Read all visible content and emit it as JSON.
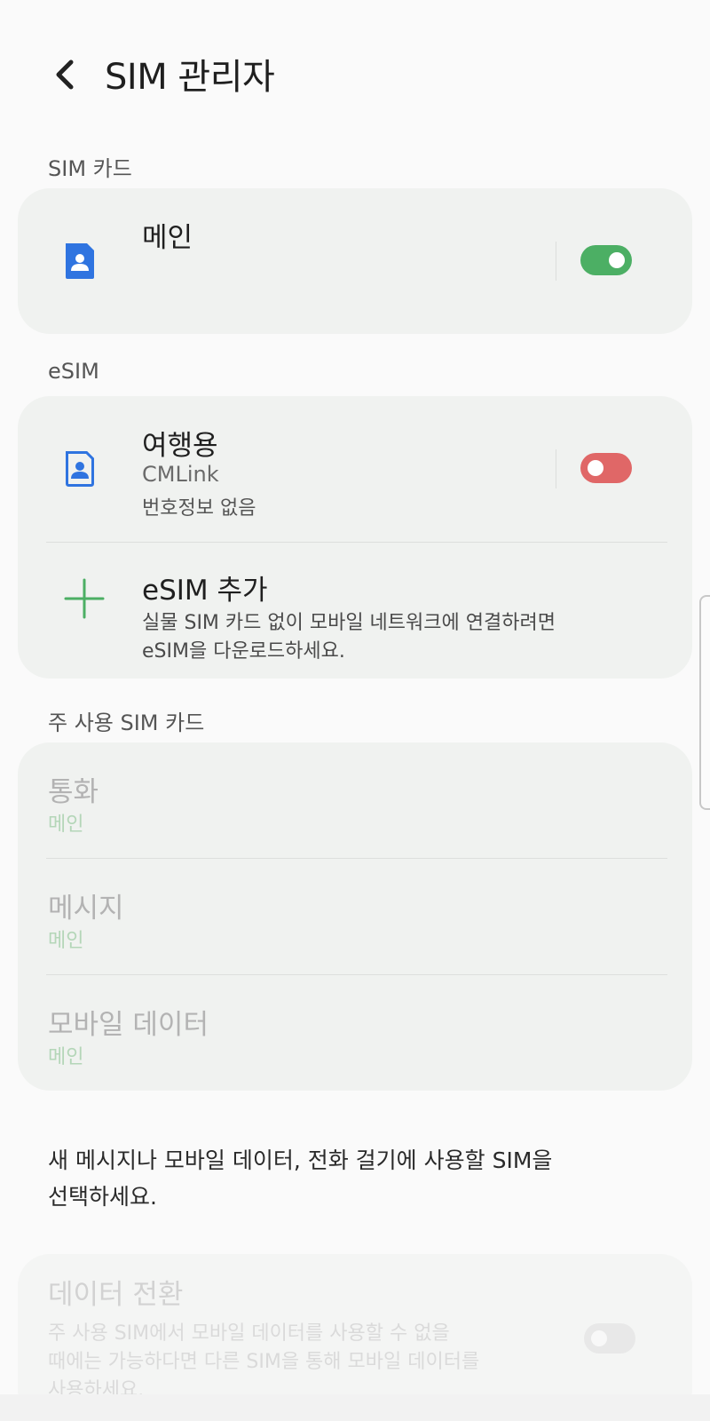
{
  "header": {
    "title": "SIM 관리자"
  },
  "sections": {
    "sim_card": "SIM 카드",
    "esim": "eSIM",
    "primary": "주 사용 SIM 카드"
  },
  "sim_cards": [
    {
      "name": "메인",
      "enabled": true,
      "toggle_color": "#4caf64"
    }
  ],
  "esims": [
    {
      "name": "여행용",
      "carrier": "CMLink",
      "number": "번호정보 없음",
      "enabled": false,
      "toggle_color": "#e06767"
    }
  ],
  "add_esim": {
    "title": "eSIM 추가",
    "desc_line1": "실물 SIM 카드 없이 모바일 네트워크에 연결하려면",
    "desc_line2": "eSIM을 다운로드하세요."
  },
  "primary_sim": [
    {
      "label": "통화",
      "value": "메인"
    },
    {
      "label": "메시지",
      "value": "메인"
    },
    {
      "label": "모바일 데이터",
      "value": "메인"
    }
  ],
  "primary_note": {
    "line1": "새 메시지나 모바일 데이터, 전화 걸기에 사용할 SIM을",
    "line2": "선택하세요."
  },
  "data_switch": {
    "title": "데이터 전환",
    "desc_line1": "주 사용 SIM에서 모바일 데이터를 사용할 수 없을",
    "desc_line2": "때에는 가능하다면 다른 SIM을 통해 모바일 데이터를",
    "desc_line3": "사용하세요.",
    "enabled": false
  },
  "colors": {
    "accent_green": "#4caf64",
    "icon_blue": "#2f74e0",
    "toggle_off_red": "#e06767"
  }
}
